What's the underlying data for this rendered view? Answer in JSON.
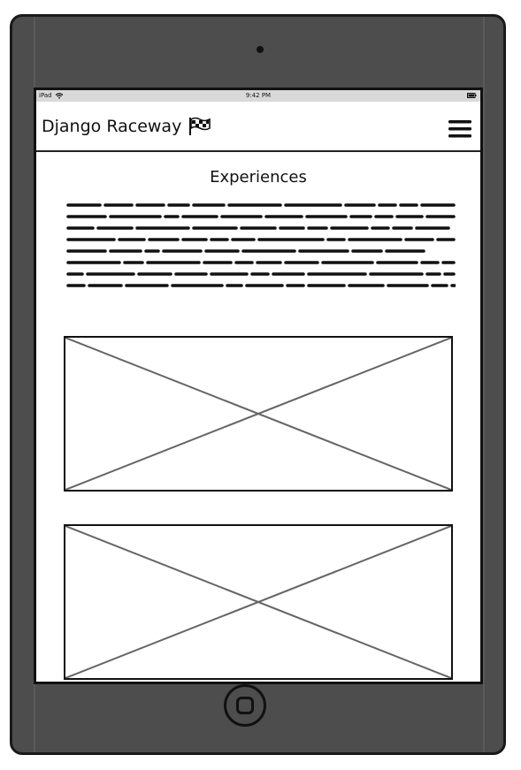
{
  "status_bar": {
    "device": "iPad",
    "time": "9:42 PM",
    "wifi_icon": "wifi-icon",
    "battery_icon": "battery-icon"
  },
  "navbar": {
    "brand": "Django Raceway",
    "brand_icon": "checkered-flag-icon",
    "menu_icon": "hamburger-menu-icon"
  },
  "main": {
    "heading": "Experiences",
    "paragraph_lines": 8,
    "image_placeholders": [
      "image-placeholder",
      "image-placeholder"
    ]
  },
  "colors": {
    "device_frame": "#4d4d4d",
    "screen_bg": "#ffffff",
    "status_bar_bg": "#d9d9d9",
    "ink": "#111111",
    "placeholder_cross": "#666666"
  }
}
